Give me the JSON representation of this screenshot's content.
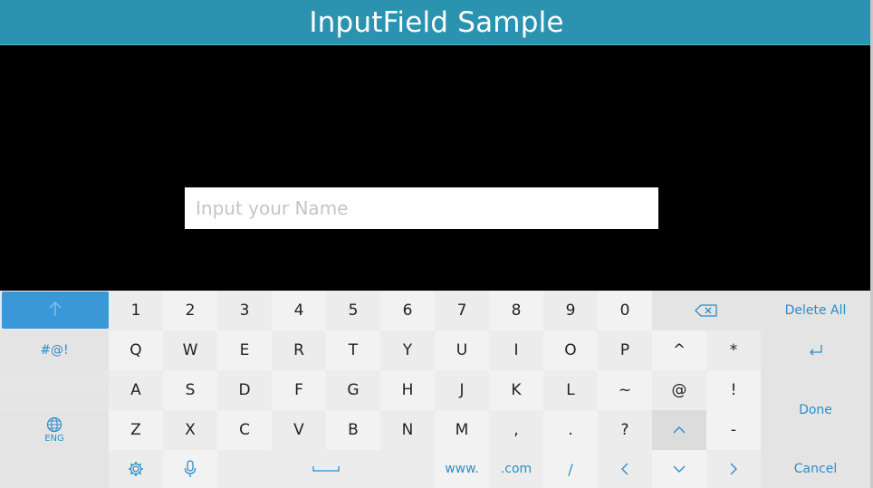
{
  "app": {
    "title": "InputField Sample"
  },
  "input": {
    "placeholder": "Input your Name",
    "value": ""
  },
  "keyboard": {
    "number_row": [
      "1",
      "2",
      "3",
      "4",
      "5",
      "6",
      "7",
      "8",
      "9",
      "0"
    ],
    "row_q": [
      "Q",
      "W",
      "E",
      "R",
      "T",
      "Y",
      "U",
      "I",
      "O",
      "P",
      "^",
      "*"
    ],
    "row_a": [
      "A",
      "S",
      "D",
      "F",
      "G",
      "H",
      "J",
      "K",
      "L",
      "~",
      "@",
      "!"
    ],
    "row_z": [
      "Z",
      "X",
      "C",
      "V",
      "B",
      "N",
      "M",
      ",",
      ".",
      "?",
      "-"
    ],
    "symbols_label": "#@!",
    "delete_all_label": "Delete All",
    "done_label": "Done",
    "cancel_label": "Cancel",
    "www_label": "www.",
    "com_label": ".com",
    "slash_label": "/",
    "language_label": "ENG",
    "icons": [
      "shift-arrow-icon",
      "backspace-icon",
      "enter-icon",
      "globe-icon",
      "settings-gear-icon",
      "microphone-icon",
      "space-bar-icon",
      "caret-up-icon",
      "chevron-left-icon",
      "chevron-down-icon",
      "chevron-right-icon"
    ]
  },
  "colors": {
    "title_bar": "#2b93b0",
    "shift_key": "#3b98d8",
    "accent_text": "#2b8ec9",
    "keyboard_bg": "#e6e6e6"
  }
}
